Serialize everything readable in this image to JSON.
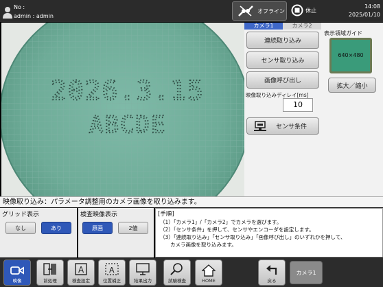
{
  "header": {
    "no_label": "No :",
    "user_label": "admin : admin",
    "offline_label": "オフライン",
    "stop_label": "休止",
    "time": "14:08",
    "date": "2025/01/10"
  },
  "camera_image": {
    "line1": "2026.3.15",
    "line2": "ABCDE"
  },
  "side_panel": {
    "tabs": [
      "カメラ1",
      "カメラ2"
    ],
    "continuous_capture": "連続取り込み",
    "sensor_capture": "センサ取り込み",
    "image_recall": "画像呼び出し",
    "delay_label": "映像取り込みディレイ[ms]",
    "delay_value": "10",
    "sensor_condition": "センサ条件"
  },
  "guide": {
    "title": "表示領域ガイド",
    "thumb_text": "640×480",
    "zoom_button": "拡大／縮小"
  },
  "status_message": "映像取り込み：パラメータ調整用のカメラ画像を取り込みます。",
  "grid_display": {
    "title": "グリッド表示",
    "off": "なし",
    "on": "あり"
  },
  "inspection_display": {
    "title": "検査映像表示",
    "original": "原画",
    "binary": "2値"
  },
  "procedure": {
    "title": "[手順]",
    "steps": [
      "（1）「カメラ1」/「カメラ2」でカメラを選びます。",
      "（2）「センサ条件」を押して、センサやエンコーダを設定します。",
      "（3）「連続取り込み」「センサ取り込み」「画像呼び出し」のいずれかを押して、",
      "　　カメラ画像を取り込みます。"
    ]
  },
  "toolbar": {
    "video": "映像",
    "preprocess": "前処理",
    "inspection_settings": "検査設定",
    "position_correction": "位置補正",
    "result_output": "結果出力",
    "test_inspection": "試験検査",
    "home": "HOME",
    "back": "戻る",
    "camera": "カメラ1"
  },
  "colors": {
    "accent_blue": "#2f58b8",
    "dark_bar": "#2c2c2c",
    "camera_bg": "#e4e8e4",
    "guide_green": "#3a9b7a"
  }
}
